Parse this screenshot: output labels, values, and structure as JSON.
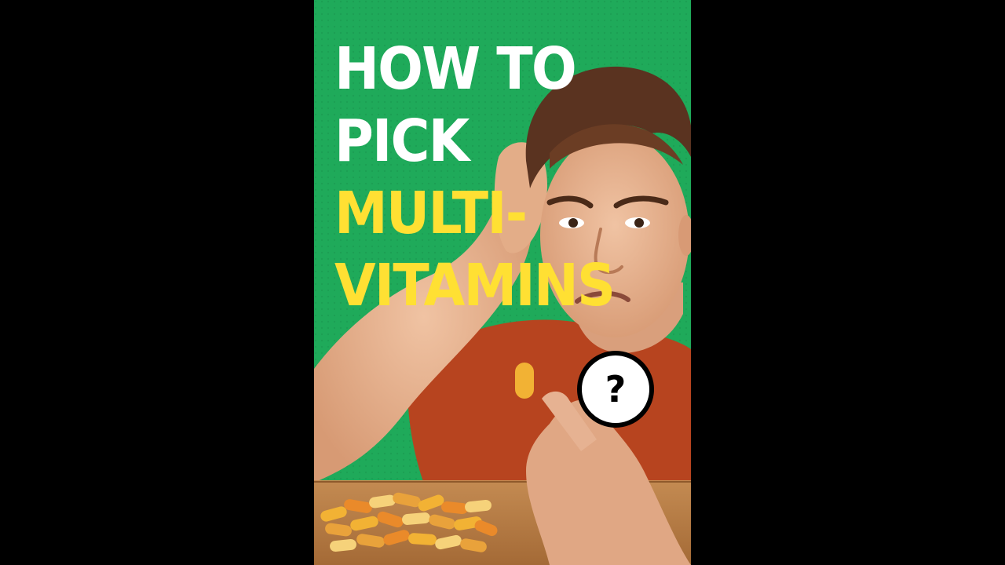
{
  "thumbnail": {
    "headline": {
      "line1": "HOW TO",
      "line2": "PICK",
      "line3": "MULTI-",
      "line4": "VITAMINS"
    },
    "badge": {
      "symbol": "?",
      "icon": "question-mark-icon"
    },
    "colors": {
      "background": "#1faa5a",
      "headline_primary": "#ffffff",
      "headline_accent": "#ffe033",
      "shirt": "#b7441f",
      "table": "#b07a42",
      "pills": [
        "#f2b234",
        "#ea8a2a",
        "#f6d27a",
        "#e9a23b"
      ]
    }
  }
}
